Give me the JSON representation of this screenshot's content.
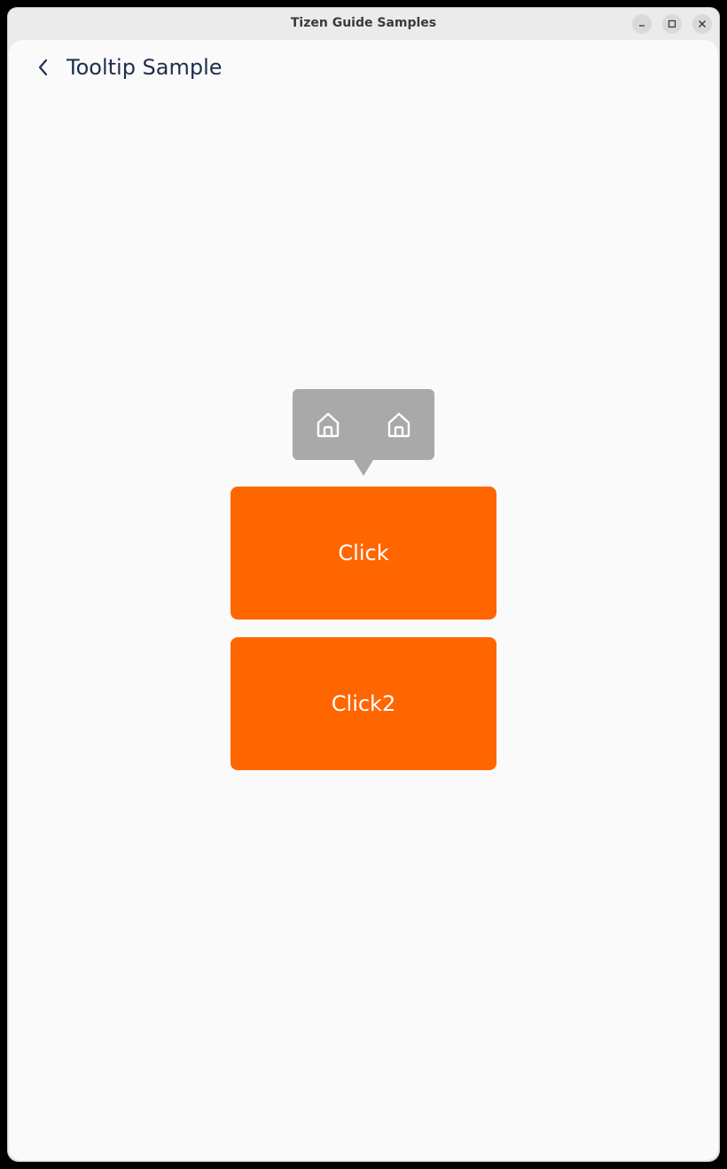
{
  "window": {
    "title": "Tizen Guide Samples",
    "controls": {
      "minimize_icon": "minimize-icon",
      "maximize_icon": "maximize-icon",
      "close_icon": "close-icon"
    }
  },
  "header": {
    "back_icon": "chevron-left-icon",
    "title": "Tooltip Sample"
  },
  "tooltip": {
    "icons": [
      "home-icon",
      "home-icon"
    ],
    "background": "#a9a9a9"
  },
  "buttons": [
    {
      "label": "Click",
      "color": "#ff6600"
    },
    {
      "label": "Click2",
      "color": "#ff6600"
    }
  ],
  "colors": {
    "accent": "#ff6600",
    "title_text": "#1f2d4f",
    "content_bg": "#fafafa"
  }
}
